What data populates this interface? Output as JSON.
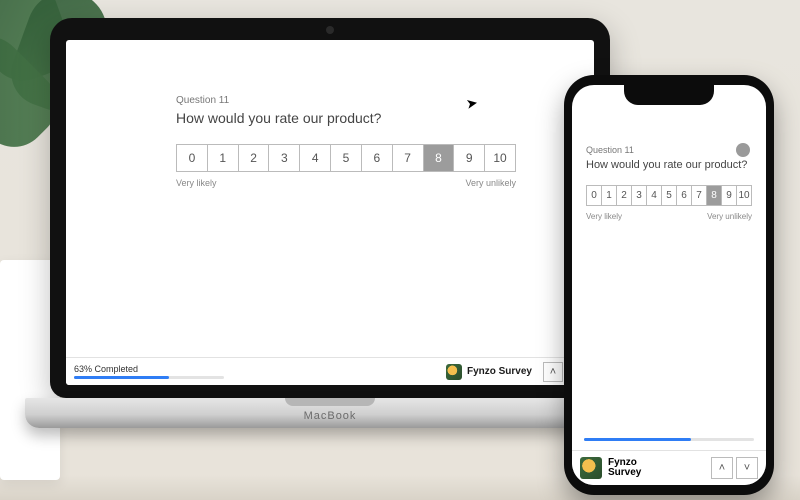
{
  "survey": {
    "question_kicker": "Question 11",
    "question_text": "How would you rate our product?",
    "choices": [
      "0",
      "1",
      "2",
      "3",
      "4",
      "5",
      "6",
      "7",
      "8",
      "9",
      "10"
    ],
    "selected_index": 8,
    "min_label": "Very likely",
    "max_label": "Very unlikely"
  },
  "footer": {
    "progress_text": "63% Completed",
    "progress_percent": 63,
    "brand_name": "Fynzo Survey",
    "brand_name_line1": "Fynzo",
    "brand_name_line2": "Survey",
    "prev_glyph": "˄",
    "next_glyph": "˅"
  },
  "device": {
    "laptop_brand": "MacBook"
  },
  "colors": {
    "accent": "#2f7df5",
    "selected_bg": "#9c9c9c"
  }
}
